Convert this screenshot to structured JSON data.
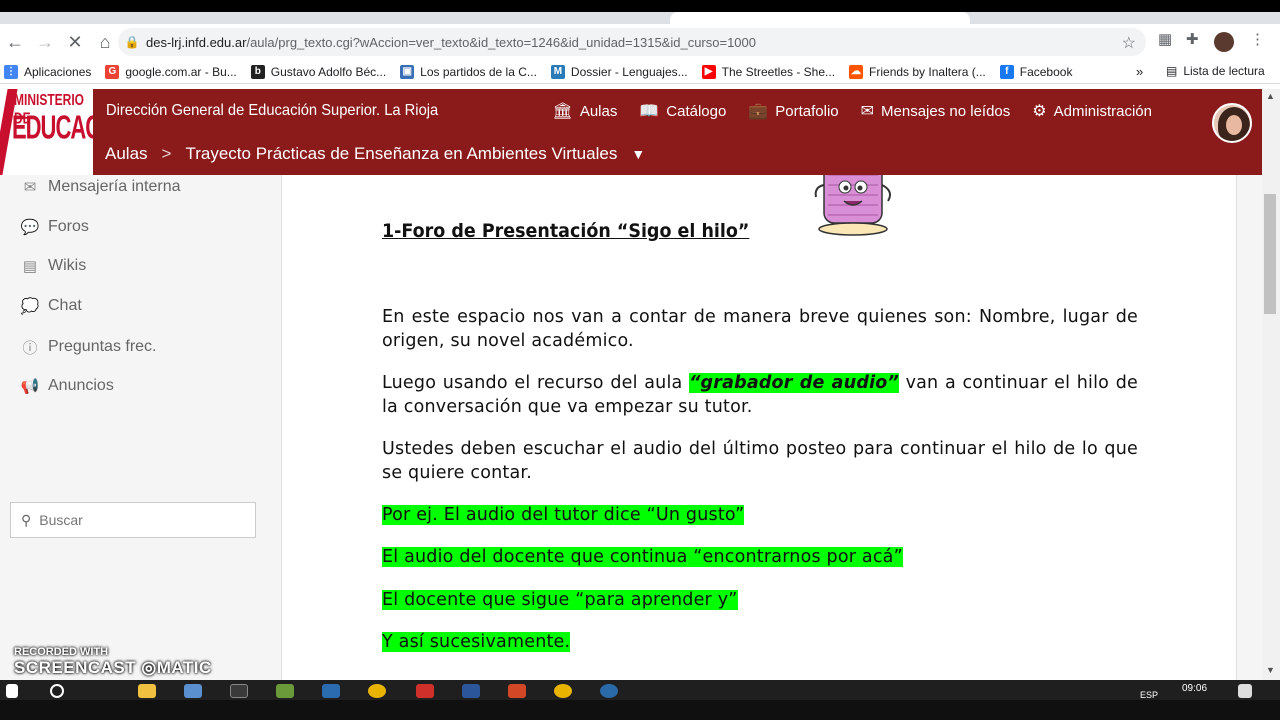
{
  "browser": {
    "url_host": "des-lrj.infd.edu.ar",
    "url_path": "/aula/prg_texto.cgi?wAccion=ver_texto&id_texto=1246&id_unidad=1315&id_curso=1000",
    "bookmarks": [
      {
        "label": "Aplicaciones",
        "icon": "apps-grid-icon",
        "color": "#4285f4"
      },
      {
        "label": "google.com.ar - Bu...",
        "icon": "google-icon",
        "color": "#ea4335"
      },
      {
        "label": "Gustavo Adolfo Béc...",
        "icon": "b-icon",
        "color": "#222222"
      },
      {
        "label": "Los partidos de la C...",
        "icon": "page-icon",
        "color": "#3b6fb6"
      },
      {
        "label": "Dossier - Lenguajes...",
        "icon": "me-icon",
        "color": "#2a7ab8"
      },
      {
        "label": "The Streetles - She...",
        "icon": "youtube-icon",
        "color": "#ff0000"
      },
      {
        "label": "Friends by Inaltera (...",
        "icon": "soundcloud-icon",
        "color": "#ff5500"
      },
      {
        "label": "Facebook",
        "icon": "facebook-icon",
        "color": "#1877f2"
      }
    ],
    "reading_list": "Lista de lectura",
    "more": "»"
  },
  "site": {
    "logo_line1": "MINISTERIO DE",
    "logo_line2": "EDUCACION",
    "title": "Dirección General de Educación Superior. La Rioja",
    "nav": [
      {
        "label": "Aulas",
        "icon": "institution-icon"
      },
      {
        "label": "Catálogo",
        "icon": "book-icon"
      },
      {
        "label": "Portafolio",
        "icon": "briefcase-icon"
      },
      {
        "label": "Mensajes no leídos",
        "icon": "envelope-icon"
      },
      {
        "label": "Administración",
        "icon": "gear-icon"
      }
    ],
    "breadcrumb": {
      "root": "Aulas",
      "current": "Trayecto Prácticas de Enseñanza en Ambientes Virtuales"
    }
  },
  "sidebar": {
    "items": [
      {
        "label": "Mensajería interna",
        "icon": "envelope-icon"
      },
      {
        "label": "Foros",
        "icon": "chat-bubbles-icon"
      },
      {
        "label": "Wikis",
        "icon": "wiki-icon"
      },
      {
        "label": "Chat",
        "icon": "chat-icon"
      },
      {
        "label": "Preguntas frec.",
        "icon": "info-icon"
      },
      {
        "label": "Anuncios",
        "icon": "megaphone-icon"
      }
    ],
    "search_placeholder": "Buscar"
  },
  "content": {
    "title": "1-Foro de Presentación “Sigo el hilo”",
    "p1": "En este espacio nos van a contar de manera breve quienes son: Nombre, lugar de origen, su novel académico.",
    "p2_before": "Luego usando el recurso del aula ",
    "p2_highlight": "“grabador de audio”",
    "p2_after": " van a continuar el hilo de la conversación que va empezar su tutor.",
    "p3": "Ustedes deben escuchar el audio del último posteo para continuar  el hilo de lo que se quiere contar.",
    "ex1": "Por ej. El audio del tutor dice “Un gusto”",
    "ex2": "El audio del docente que continua “encontrarnos por acá”",
    "ex3": "El docente que sigue “para aprender y”",
    "ex4": "Y así sucesivamente."
  },
  "watermark": {
    "line1": "RECORDED WITH",
    "line2": "SCREENCAST",
    "line3": "MATIC"
  },
  "taskbar": {
    "time": "09:06",
    "lang": "ESP"
  }
}
